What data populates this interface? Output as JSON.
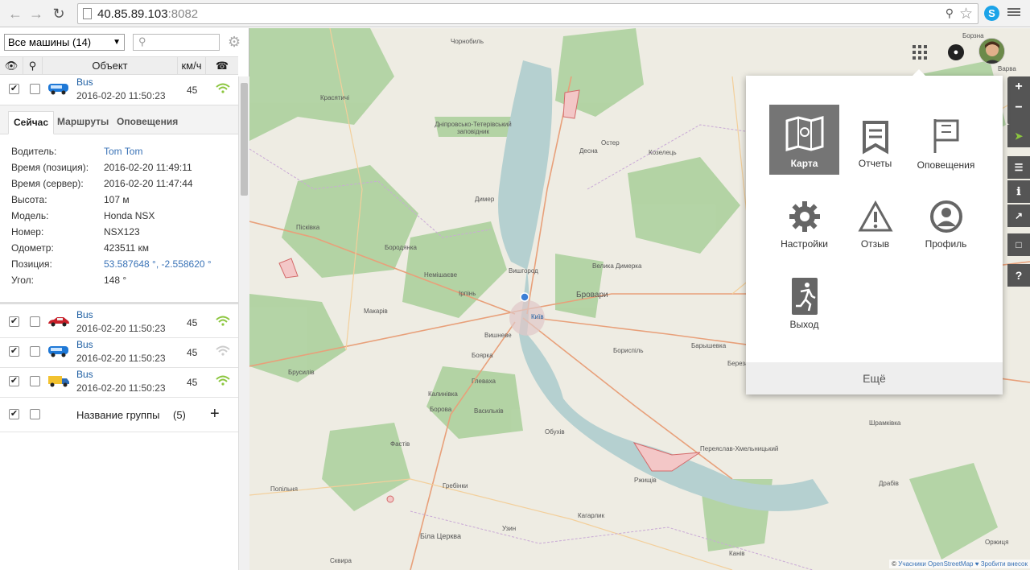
{
  "browser": {
    "url_host": "40.85.89.103",
    "url_port": ":8082"
  },
  "sidebar": {
    "group_select": "Все машины (14)",
    "search_placeholder": "",
    "columns": {
      "object": "Объект",
      "speed": "км/ч"
    },
    "selected_vehicle": {
      "name": "Bus",
      "time": "2016-02-20 11:50:23",
      "speed": "45"
    },
    "tabs": [
      "Сейчас",
      "Маршруты",
      "Оповещения"
    ],
    "properties": [
      {
        "label": "Водитель:",
        "value": "Tom Tom"
      },
      {
        "label": "Время (позиция):",
        "value": "2016-02-20 11:49:11"
      },
      {
        "label": "Время (сервер):",
        "value": "2016-02-20 11:47:44"
      },
      {
        "label": "Высота:",
        "value": "107 м"
      },
      {
        "label": "Модель:",
        "value": "Honda NSX"
      },
      {
        "label": "Номер:",
        "value": "NSX123"
      },
      {
        "label": "Одометр:",
        "value": "423511 км"
      },
      {
        "label": "Позиция:",
        "value": "53.587648 °, -2.558620 °"
      },
      {
        "label": "Угол:",
        "value": "148 °"
      }
    ],
    "vehicles": [
      {
        "name": "Bus",
        "time": "2016-02-20 11:50:23",
        "speed": "45",
        "icon": "red-car-icon"
      },
      {
        "name": "Bus",
        "time": "2016-02-20 11:50:23",
        "speed": "45",
        "icon": "blue-bus-icon"
      },
      {
        "name": "Bus",
        "time": "2016-02-20 11:50:23",
        "speed": "45",
        "icon": "truck-icon"
      }
    ],
    "group": {
      "name": "Название группы",
      "count": "(5)",
      "add": "+"
    }
  },
  "map": {
    "labels": [
      "Чорнобиль",
      "Красятичі",
      "Дніпровсько-Тетерівський заповідник",
      "Остер",
      "Козелець",
      "Десна",
      "Димер",
      "Піскiвка",
      "Бородянка",
      "Немішаєве",
      "Вишгород",
      "Велика Димерка",
      "Ірпінь",
      "Макарів",
      "Бровари",
      "Київ",
      "Вишневе",
      "Боярка",
      "Бориспіль",
      "Барышевка",
      "Березань",
      "Брусилів",
      "Глеваха",
      "Калинівка",
      "Васильків",
      "Борова",
      "Обухів",
      "Фастів",
      "Переяслав-Хмельницький",
      "Шрамківка",
      "Ржищів",
      "Гребінки",
      "Кагарлик",
      "Попільня",
      "Біла Церква",
      "Узин",
      "Драбів",
      "Сквира",
      "Канів",
      "Оржиця",
      "Борзна",
      "Варва"
    ],
    "attribution_prefix": "© ",
    "attribution_link": "Учасники OpenStreetMap",
    "attribution_suffix": " ♥ Зробити внесок",
    "zoom_in": "+",
    "zoom_out": "−",
    "help": "?"
  },
  "apps_panel": {
    "items": [
      {
        "label": "Карта",
        "icon": "map-icon",
        "active": true
      },
      {
        "label": "Отчеты",
        "icon": "report-icon"
      },
      {
        "label": "Оповещения",
        "icon": "flag-icon"
      },
      {
        "label": "Настройки",
        "icon": "gear-icon"
      },
      {
        "label": "Отзыв",
        "icon": "warning-icon"
      },
      {
        "label": "Профиль",
        "icon": "profile-icon"
      },
      {
        "label": "Выход",
        "icon": "exit-icon"
      }
    ],
    "more": "Ещё"
  }
}
